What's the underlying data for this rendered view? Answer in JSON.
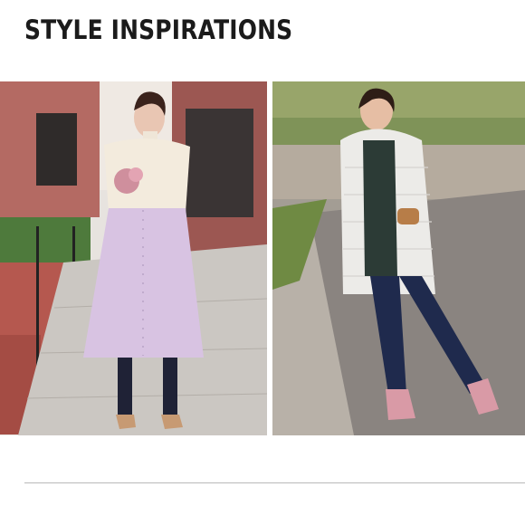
{
  "section": {
    "title": "STYLE INSPIRATIONS"
  },
  "inspirations": [
    {
      "photo": "woman-in-cream-turtleneck-lilac-button-skirt-holding-bouquet",
      "colors": {
        "top": "#f3ebdd",
        "skirt": "#d8c3e2",
        "tights": "#1f2236",
        "bricks": "#a8524d",
        "pavement": "#c9c5c0"
      }
    },
    {
      "photo": "woman-in-white-puffer-coat-navy-trousers-pink-sneakers",
      "colors": {
        "coat": "#ecebe8",
        "shirt": "#2c3b36",
        "trousers": "#1f2a4d",
        "sneakers": "#d99aa6",
        "road": "#8a8480",
        "foliage": "#8fa35c"
      }
    }
  ]
}
